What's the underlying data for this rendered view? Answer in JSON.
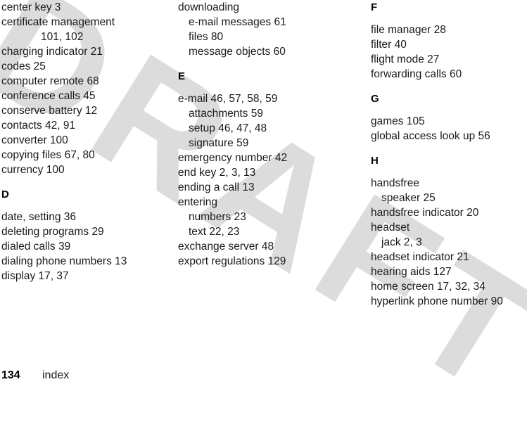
{
  "page": {
    "folio": "134",
    "section_name": "index",
    "watermark_text": "DRAFT",
    "watermark_color": "#dcdcdc",
    "text_color": "#1a1a1a"
  },
  "columns": [
    {
      "id": "column-1",
      "blocks": [
        {
          "heading": null,
          "entries": [
            {
              "level": 0,
              "text": "center key  3"
            },
            {
              "level": 0,
              "text": "certificate management"
            },
            {
              "level": 2,
              "text": "101, 102"
            },
            {
              "level": 0,
              "text": "charging indicator  21"
            },
            {
              "level": 0,
              "text": "codes  25"
            },
            {
              "level": 0,
              "text": "computer remote  68"
            },
            {
              "level": 0,
              "text": "conference calls  45"
            },
            {
              "level": 0,
              "text": "conserve battery  12"
            },
            {
              "level": 0,
              "text": "contacts  42, 91"
            },
            {
              "level": 0,
              "text": "converter  100"
            },
            {
              "level": 0,
              "text": "copying files  67, 80"
            },
            {
              "level": 0,
              "text": "currency  100"
            }
          ]
        },
        {
          "heading": "D",
          "entries": [
            {
              "level": 0,
              "text": "date, setting  36"
            },
            {
              "level": 0,
              "text": "deleting programs  29"
            },
            {
              "level": 0,
              "text": "dialed calls  39"
            },
            {
              "level": 0,
              "text": "dialing phone numbers  13"
            },
            {
              "level": 0,
              "text": "display  17, 37"
            }
          ]
        }
      ]
    },
    {
      "id": "column-2",
      "blocks": [
        {
          "heading": null,
          "entries": [
            {
              "level": 0,
              "text": "downloading"
            },
            {
              "level": 1,
              "text": "e-mail messages  61"
            },
            {
              "level": 1,
              "text": "files  80"
            },
            {
              "level": 1,
              "text": "message objects  60"
            }
          ]
        },
        {
          "heading": "E",
          "entries": [
            {
              "level": 0,
              "text": "e-mail  46, 57, 58, 59"
            },
            {
              "level": 1,
              "text": "attachments  59"
            },
            {
              "level": 1,
              "text": "setup  46, 47, 48"
            },
            {
              "level": 1,
              "text": "signature  59"
            },
            {
              "level": 0,
              "text": "emergency number  42"
            },
            {
              "level": 0,
              "text": "end key  2, 3, 13"
            },
            {
              "level": 0,
              "text": "ending a call  13"
            },
            {
              "level": 0,
              "text": "entering"
            },
            {
              "level": 1,
              "text": "numbers  23"
            },
            {
              "level": 1,
              "text": "text  22, 23"
            },
            {
              "level": 0,
              "text": "exchange server  48"
            },
            {
              "level": 0,
              "text": "export regulations  129"
            }
          ]
        }
      ]
    },
    {
      "id": "column-3",
      "blocks": [
        {
          "heading": "F",
          "entries": [
            {
              "level": 0,
              "text": "file manager  28"
            },
            {
              "level": 0,
              "text": "filter  40"
            },
            {
              "level": 0,
              "text": "flight mode  27"
            },
            {
              "level": 0,
              "text": "forwarding calls  60"
            }
          ]
        },
        {
          "heading": "G",
          "entries": [
            {
              "level": 0,
              "text": "games  105"
            },
            {
              "level": 0,
              "text": "global access look up  56"
            }
          ]
        },
        {
          "heading": "H",
          "entries": [
            {
              "level": 0,
              "text": "handsfree"
            },
            {
              "level": 1,
              "text": "speaker  25"
            },
            {
              "level": 0,
              "text": "handsfree indicator  20"
            },
            {
              "level": 0,
              "text": "headset"
            },
            {
              "level": 1,
              "text": "jack  2, 3"
            },
            {
              "level": 0,
              "text": "headset indicator  21"
            },
            {
              "level": 0,
              "text": "hearing aids  127"
            },
            {
              "level": 0,
              "text": "home screen  17, 32, 34"
            },
            {
              "level": 0,
              "text": "hyperlink phone number  90"
            }
          ]
        }
      ]
    }
  ]
}
